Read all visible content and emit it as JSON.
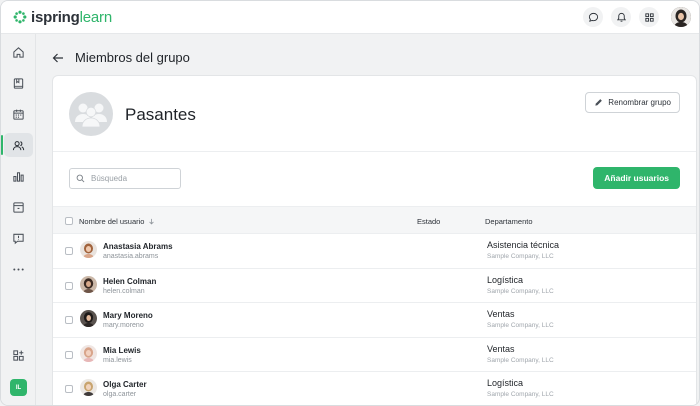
{
  "app": {
    "logo_prefix": "ispring",
    "logo_suffix": "learn",
    "user_initials": "IL",
    "accent": "#2fb56b"
  },
  "topbar": {
    "icons": [
      "chat-icon",
      "bell-icon",
      "apps-grid-icon"
    ]
  },
  "sidebar": {
    "items": [
      {
        "name": "home-icon",
        "active": false
      },
      {
        "name": "courses-book-icon",
        "active": false
      },
      {
        "name": "calendar-icon",
        "active": false
      },
      {
        "name": "users-icon",
        "active": true
      },
      {
        "name": "reports-chart-icon",
        "active": false
      },
      {
        "name": "catalog-icon",
        "active": false
      },
      {
        "name": "help-chat-icon",
        "active": false
      },
      {
        "name": "more-dots-icon",
        "active": false
      }
    ]
  },
  "header": {
    "title": "Miembros del grupo"
  },
  "group": {
    "name": "Pasantes",
    "rename_label": "Renombrar grupo"
  },
  "toolbar": {
    "search_placeholder": "Búsqueda",
    "add_label": "Añadir usuarios"
  },
  "table": {
    "columns": {
      "name": "Nombre del usuario",
      "status": "Estado",
      "department": "Departamento"
    },
    "rows": [
      {
        "name": "Anastasia Abrams",
        "login": "anastasia.abrams",
        "status": "",
        "department": "Asistencia técnica",
        "company": "Sample Company, LLC"
      },
      {
        "name": "Helen Colman",
        "login": "helen.colman",
        "status": "",
        "department": "Logística",
        "company": "Sample Company, LLC"
      },
      {
        "name": "Mary Moreno",
        "login": "mary.moreno",
        "status": "",
        "department": "Ventas",
        "company": "Sample Company, LLC"
      },
      {
        "name": "Mia Lewis",
        "login": "mia.lewis",
        "status": "",
        "department": "Ventas",
        "company": "Sample Company, LLC"
      },
      {
        "name": "Olga Carter",
        "login": "olga.carter",
        "status": "",
        "department": "Logística",
        "company": "Sample Company, LLC"
      }
    ]
  }
}
